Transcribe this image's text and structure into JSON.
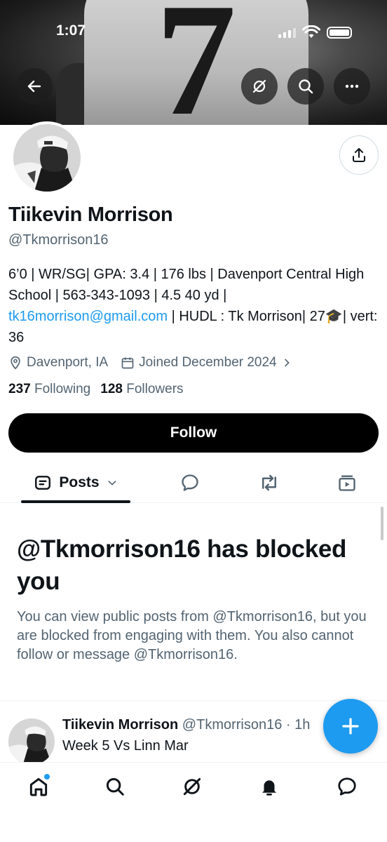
{
  "status_bar": {
    "time": "1:07"
  },
  "banner": {
    "jersey_number": "7"
  },
  "profile": {
    "name": "Tiikevin Morrison",
    "handle": "@Tkmorrison16",
    "bio_part1": "6’0 | WR/SG| GPA: 3.4 | 176 lbs | Davenport Central High School | 563-343-1093 | 4.5 40 yd | ",
    "bio_link": "tk16morrison@gmail.com",
    "bio_part2": " | HUDL : Tk Morrison| 27🎓| vert: 36",
    "location": "Davenport, IA",
    "joined": "Joined December 2024",
    "following_count": "237",
    "following_label": "Following",
    "followers_count": "128",
    "followers_label": "Followers",
    "follow_button": "Follow"
  },
  "tabs": {
    "posts_label": "Posts",
    "items": [
      "posts",
      "replies",
      "reposts",
      "media"
    ]
  },
  "blocked": {
    "title": "@Tkmorrison16 has blocked you",
    "description": "You can view public posts from @Tkmorrison16, but you are blocked from engaging with them. You also cannot follow or message @Tkmorrison16."
  },
  "post": {
    "author": "Tiikevin Morrison",
    "meta": "@Tkmorrison16 · 1h",
    "text": "Week 5 Vs Linn Mar"
  },
  "bottom_nav": [
    "home",
    "search",
    "grok",
    "notifications",
    "messages"
  ],
  "colors": {
    "accent": "#1d9bf0",
    "text": "#0f1419",
    "secondary": "#536471",
    "button": "#000000"
  }
}
